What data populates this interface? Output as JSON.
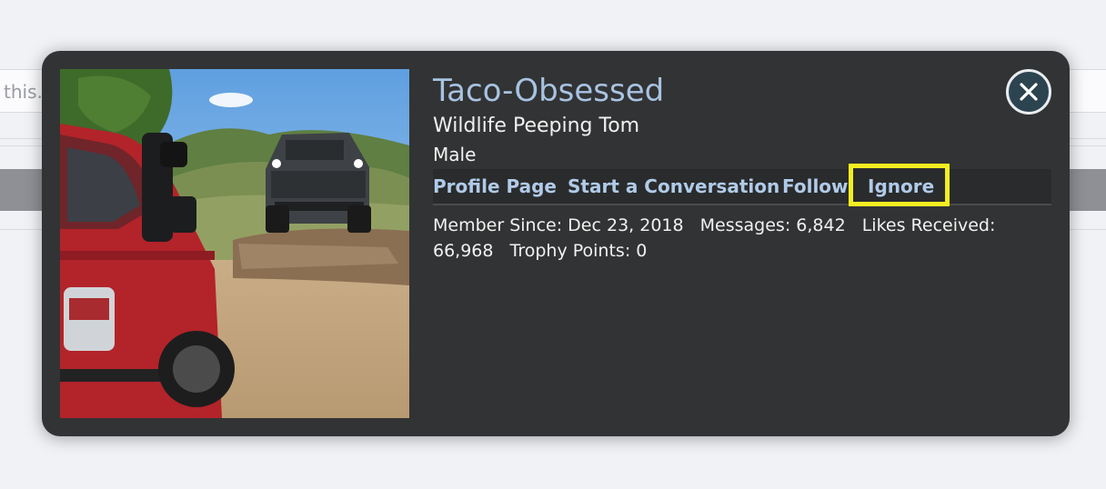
{
  "background": {
    "input_text": "this."
  },
  "popup": {
    "username": "Taco-Obsessed",
    "user_title": "Wildlife Peeping Tom",
    "gender": "Male",
    "links": {
      "profile_page": "Profile Page",
      "start_conversation": "Start a Conversation",
      "follow": "Follow",
      "ignore": "Ignore"
    },
    "stats": {
      "member_since_label": "Member Since:",
      "member_since_value": "Dec 23, 2018",
      "messages_label": "Messages:",
      "messages_value": "6,842",
      "likes_label": "Likes Received:",
      "likes_value": "66,968",
      "trophy_label": "Trophy Points:",
      "trophy_value": "0"
    },
    "close_icon": "close-icon",
    "highlight_color": "#f5ee21",
    "link_color": "#b0cbe8",
    "username_color": "#a8c3e2"
  }
}
